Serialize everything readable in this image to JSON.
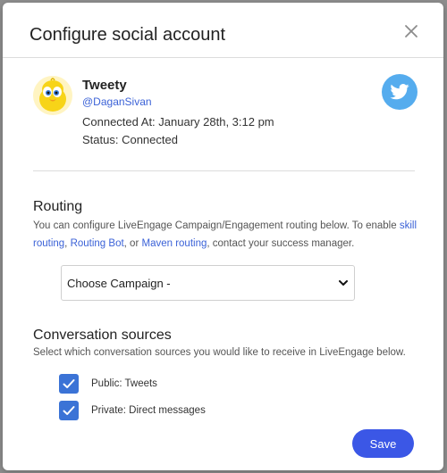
{
  "dialog": {
    "title": "Configure social account"
  },
  "account": {
    "name": "Tweety",
    "handle": "@DaganSivan",
    "connected_at": "Connected At: January 28th, 3:12 pm",
    "status": "Status: Connected",
    "avatar_icon": "tweety-avatar-icon",
    "network_icon": "twitter-bird-icon",
    "network_color": "#55acee"
  },
  "routing": {
    "title": "Routing",
    "desc_before": "You can configure LiveEngage Campaign/Engagement routing below. To enable ",
    "link_skill": "skill routing",
    "sep1": ", ",
    "link_bot": "Routing Bot",
    "sep2": ", or ",
    "link_maven": "Maven routing",
    "desc_after": ", contact your success manager.",
    "select_value": "Choose Campaign -"
  },
  "sources": {
    "title": "Conversation sources",
    "description": "Select which conversation sources you would like to receive in LiveEngage below.",
    "items": [
      {
        "label": "Public: Tweets",
        "checked": true
      },
      {
        "label": "Private: Direct messages",
        "checked": true
      }
    ]
  },
  "footer": {
    "save_label": "Save",
    "accent": "#3b57e6"
  }
}
